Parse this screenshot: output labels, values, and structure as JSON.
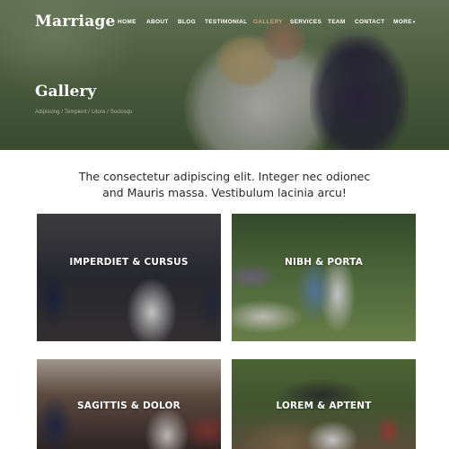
{
  "header": {
    "logo": "Marriage",
    "nav": [
      {
        "label": "HOME",
        "active": false
      },
      {
        "label": "ABOUT",
        "active": false
      },
      {
        "label": "BLOG",
        "active": false
      },
      {
        "label": "TESTIMONIAL",
        "active": false
      },
      {
        "label": "GALLERY",
        "active": true
      },
      {
        "label": "SERVICES",
        "active": false
      },
      {
        "label": "TEAM",
        "active": false
      },
      {
        "label": "CONTACT",
        "active": false
      },
      {
        "label": "MORE",
        "active": false
      }
    ],
    "more_caret": "▾"
  },
  "hero": {
    "title": "Gallery",
    "breadcrumb": [
      "Adipiscing",
      "Tempient",
      "Litora",
      "Sociosqu"
    ],
    "breadcrumb_separator": "/"
  },
  "intro": {
    "line1": "The consectetur adipiscing elit. Integer nec odionec",
    "line2": "and Mauris massa. Vestibulum lacinia arcu!"
  },
  "gallery": [
    {
      "caption": "IMPERDIET & CURSUS"
    },
    {
      "caption": "NIBH & PORTA"
    },
    {
      "caption": "SAGITTIS & DOLOR"
    },
    {
      "caption": "LOREM & APTENT"
    }
  ],
  "colors": {
    "accent": "#c9a27a",
    "nav_text": "#ffffff",
    "body_text": "#2a2a2a"
  }
}
